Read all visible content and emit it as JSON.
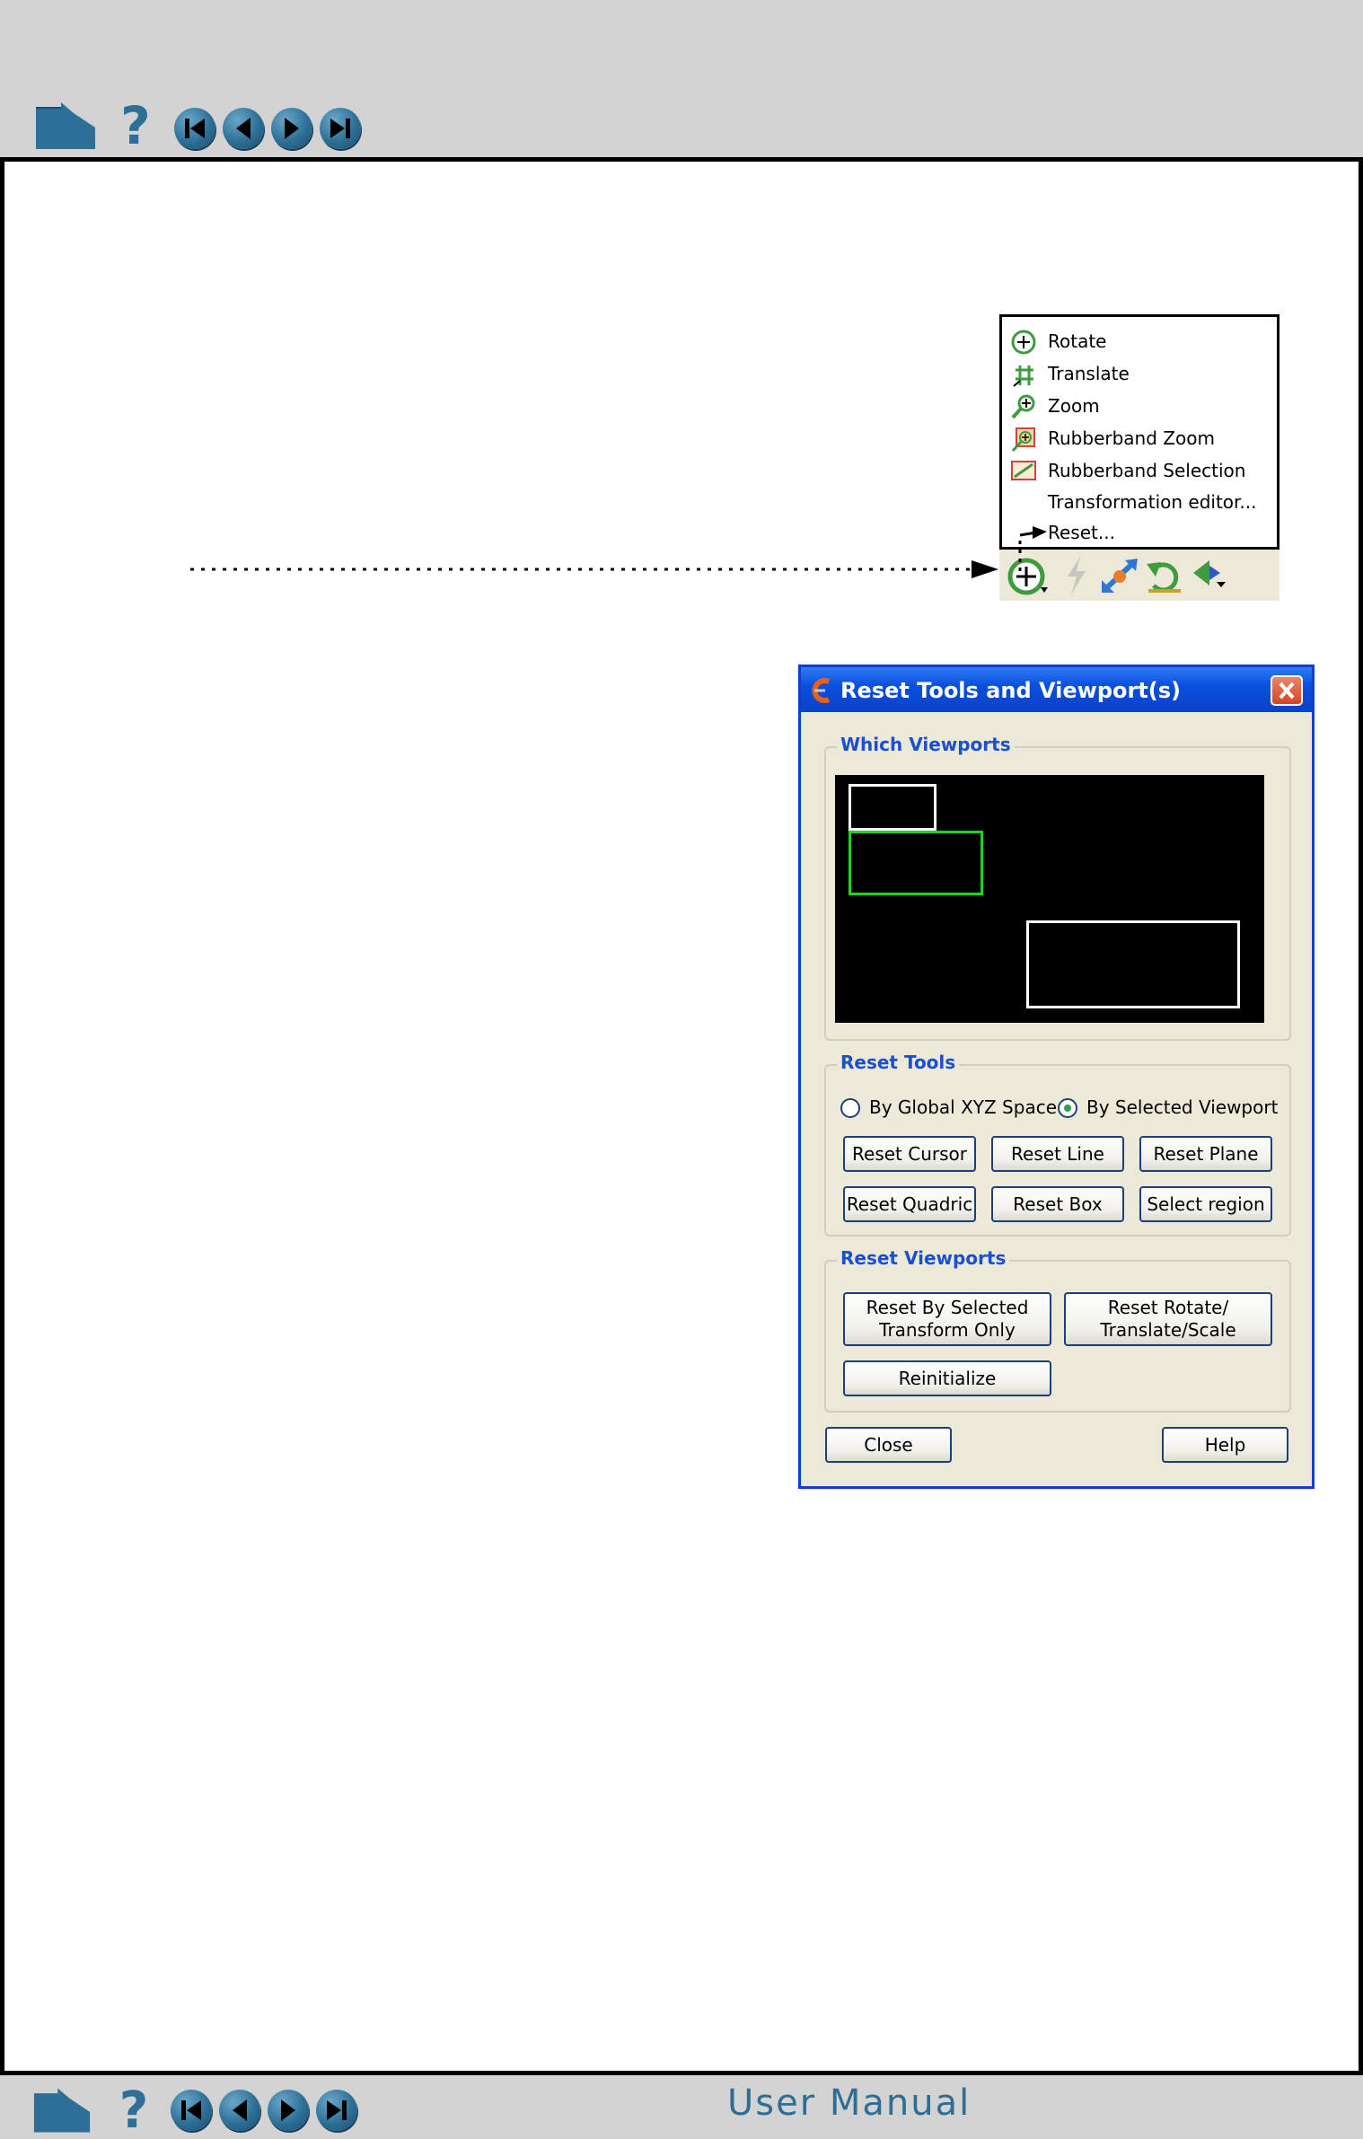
{
  "footer": {
    "title": "User Manual"
  },
  "nav_icons": [
    "home-icon",
    "help-icon",
    "first-page-icon",
    "previous-page-icon",
    "next-page-icon",
    "last-page-icon"
  ],
  "menu": {
    "items": [
      {
        "label": "Rotate",
        "icon": "rotate-icon"
      },
      {
        "label": "Translate",
        "icon": "translate-icon"
      },
      {
        "label": "Zoom",
        "icon": "zoom-icon"
      },
      {
        "label": "Rubberband Zoom",
        "icon": "rubberband-zoom-icon"
      },
      {
        "label": "Rubberband Selection",
        "icon": "rubberband-selection-icon"
      },
      {
        "label": "Transformation editor...",
        "icon": ""
      },
      {
        "label": "Reset...",
        "icon": ""
      }
    ]
  },
  "dialog": {
    "title": "Reset Tools and Viewport(s)",
    "which_viewports": {
      "label": "Which Viewports"
    },
    "reset_tools": {
      "label": "Reset Tools",
      "radio_global": "By Global XYZ Space",
      "radio_selected": "By Selected Viewport",
      "selected_option": "By Selected Viewport",
      "buttons": [
        "Reset Cursor",
        "Reset Line",
        "Reset Plane",
        "Reset Quadric",
        "Reset Box",
        "Select region"
      ]
    },
    "reset_viewports": {
      "label": "Reset Viewports",
      "btn_selected": "Reset By Selected\nTransform Only",
      "btn_rts": "Reset Rotate/\nTranslate/Scale",
      "btn_reinit": "Reinitialize"
    },
    "close": "Close",
    "help": "Help"
  },
  "colors": {
    "bar": "#d3d3d3",
    "nav_blue": "#2d6f96",
    "title_blue": "#0a4fdf",
    "group_label_blue": "#1b4fd0",
    "selected_viewport": "#1fd21f"
  }
}
